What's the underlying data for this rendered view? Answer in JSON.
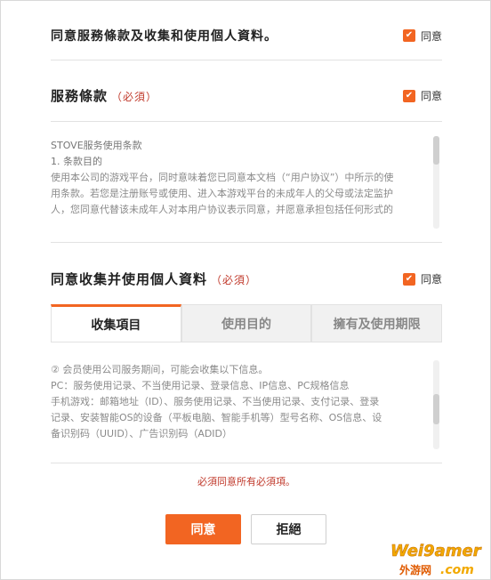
{
  "all_agree": {
    "label": "同意服務條款及收集和使用個人資料。",
    "checkbox_label": "同意"
  },
  "terms": {
    "title": "服務條款",
    "required": "（必須）",
    "checkbox_label": "同意",
    "doc_title": "STOVE服务使用条款",
    "section_title": "1. 条款目的",
    "body_lines": [
      "使用本公司的游戏平台，同时意味着您已同意本文档（“用户协议”）中所示的使",
      "用条款。若您是注册账号或使用、进入本游戏平台的未成年人的父母或法定监护",
      "人，您同意代替该未成年人对本用户协议表示同意，并愿意承担包括任何形式的"
    ]
  },
  "privacy": {
    "title": "同意收集并使用個人資料",
    "required": "（必須）",
    "checkbox_label": "同意",
    "tabs": [
      "收集項目",
      "使用目的",
      "擁有及使用期限"
    ],
    "body_lines": [
      "② 会员使用公司服务期间，可能会收集以下信息。",
      "PC：服务使用记录、不当使用记录、登录信息、IP信息、PC规格信息",
      "手机游戏：邮箱地址（ID）、服务使用记录、不当使用记录、支付记录、登录",
      "记录、安装智能OS的设备（平板电脑、智能手机等）型号名称、OS信息、设",
      "备识别码（UUID）、广告识别码（ADID）"
    ]
  },
  "error_text": "必須同意所有必須項。",
  "buttons": {
    "agree": "同意",
    "reject": "拒絕"
  },
  "watermark": {
    "line1": "Wei9amer",
    "line2": "外游网",
    "line3": ".com"
  },
  "colors": {
    "accent": "#f26522",
    "error": "#c0392b"
  }
}
